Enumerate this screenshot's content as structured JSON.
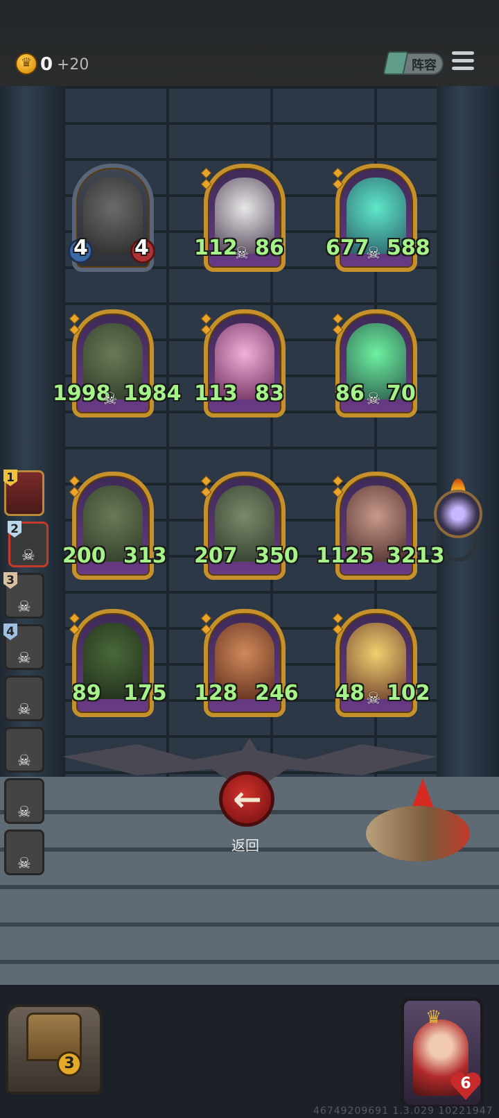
{
  "top_bar": {
    "gold": "0",
    "gold_bonus": "+20",
    "lineup_label": "阵容"
  },
  "enemy_grid": [
    {
      "row": 1,
      "items": [
        {
          "attack": "4",
          "health": "4",
          "style": "neutral",
          "has_skull": false
        },
        {
          "attack": "112",
          "health": "86",
          "style": "gold",
          "has_skull": true
        },
        {
          "attack": "677",
          "health": "588",
          "style": "gold",
          "has_skull": true
        }
      ]
    },
    {
      "row": 2,
      "items": [
        {
          "attack": "1998",
          "health": "1984",
          "style": "gold",
          "has_skull": true
        },
        {
          "attack": "113",
          "health": "83",
          "style": "gold",
          "has_skull": false
        },
        {
          "attack": "86",
          "health": "70",
          "style": "gold",
          "has_skull": true
        }
      ]
    },
    {
      "row": 3,
      "items": [
        {
          "attack": "200",
          "health": "313",
          "style": "gold",
          "has_skull": false
        },
        {
          "attack": "207",
          "health": "350",
          "style": "gold",
          "has_skull": false
        },
        {
          "attack": "1125",
          "health": "3213",
          "style": "gold",
          "has_skull": false
        }
      ]
    },
    {
      "row": 4,
      "items": [
        {
          "attack": "89",
          "health": "175",
          "style": "gold",
          "has_skull": false
        },
        {
          "attack": "128",
          "health": "246",
          "style": "gold",
          "has_skull": false
        },
        {
          "attack": "48",
          "health": "102",
          "style": "gold",
          "has_skull": true
        }
      ]
    }
  ],
  "roster": [
    {
      "number": "1",
      "state": "current"
    },
    {
      "number": "2",
      "state": "selected"
    },
    {
      "number": "3",
      "state": "defeated"
    },
    {
      "number": "4",
      "state": "defeated"
    },
    {
      "number": "",
      "state": "defeated"
    },
    {
      "number": "",
      "state": "defeated"
    },
    {
      "number": "",
      "state": "defeated"
    },
    {
      "number": "",
      "state": "defeated"
    }
  ],
  "back_button": {
    "label": "返回"
  },
  "chest": {
    "count": "3"
  },
  "hero": {
    "lives": "6"
  },
  "footer_code": "46749209691 1.3.029 10221947",
  "colors": {
    "stat_green": "#a6f38a",
    "card_gold": "#c6912a",
    "back_red": "#c0282a"
  }
}
